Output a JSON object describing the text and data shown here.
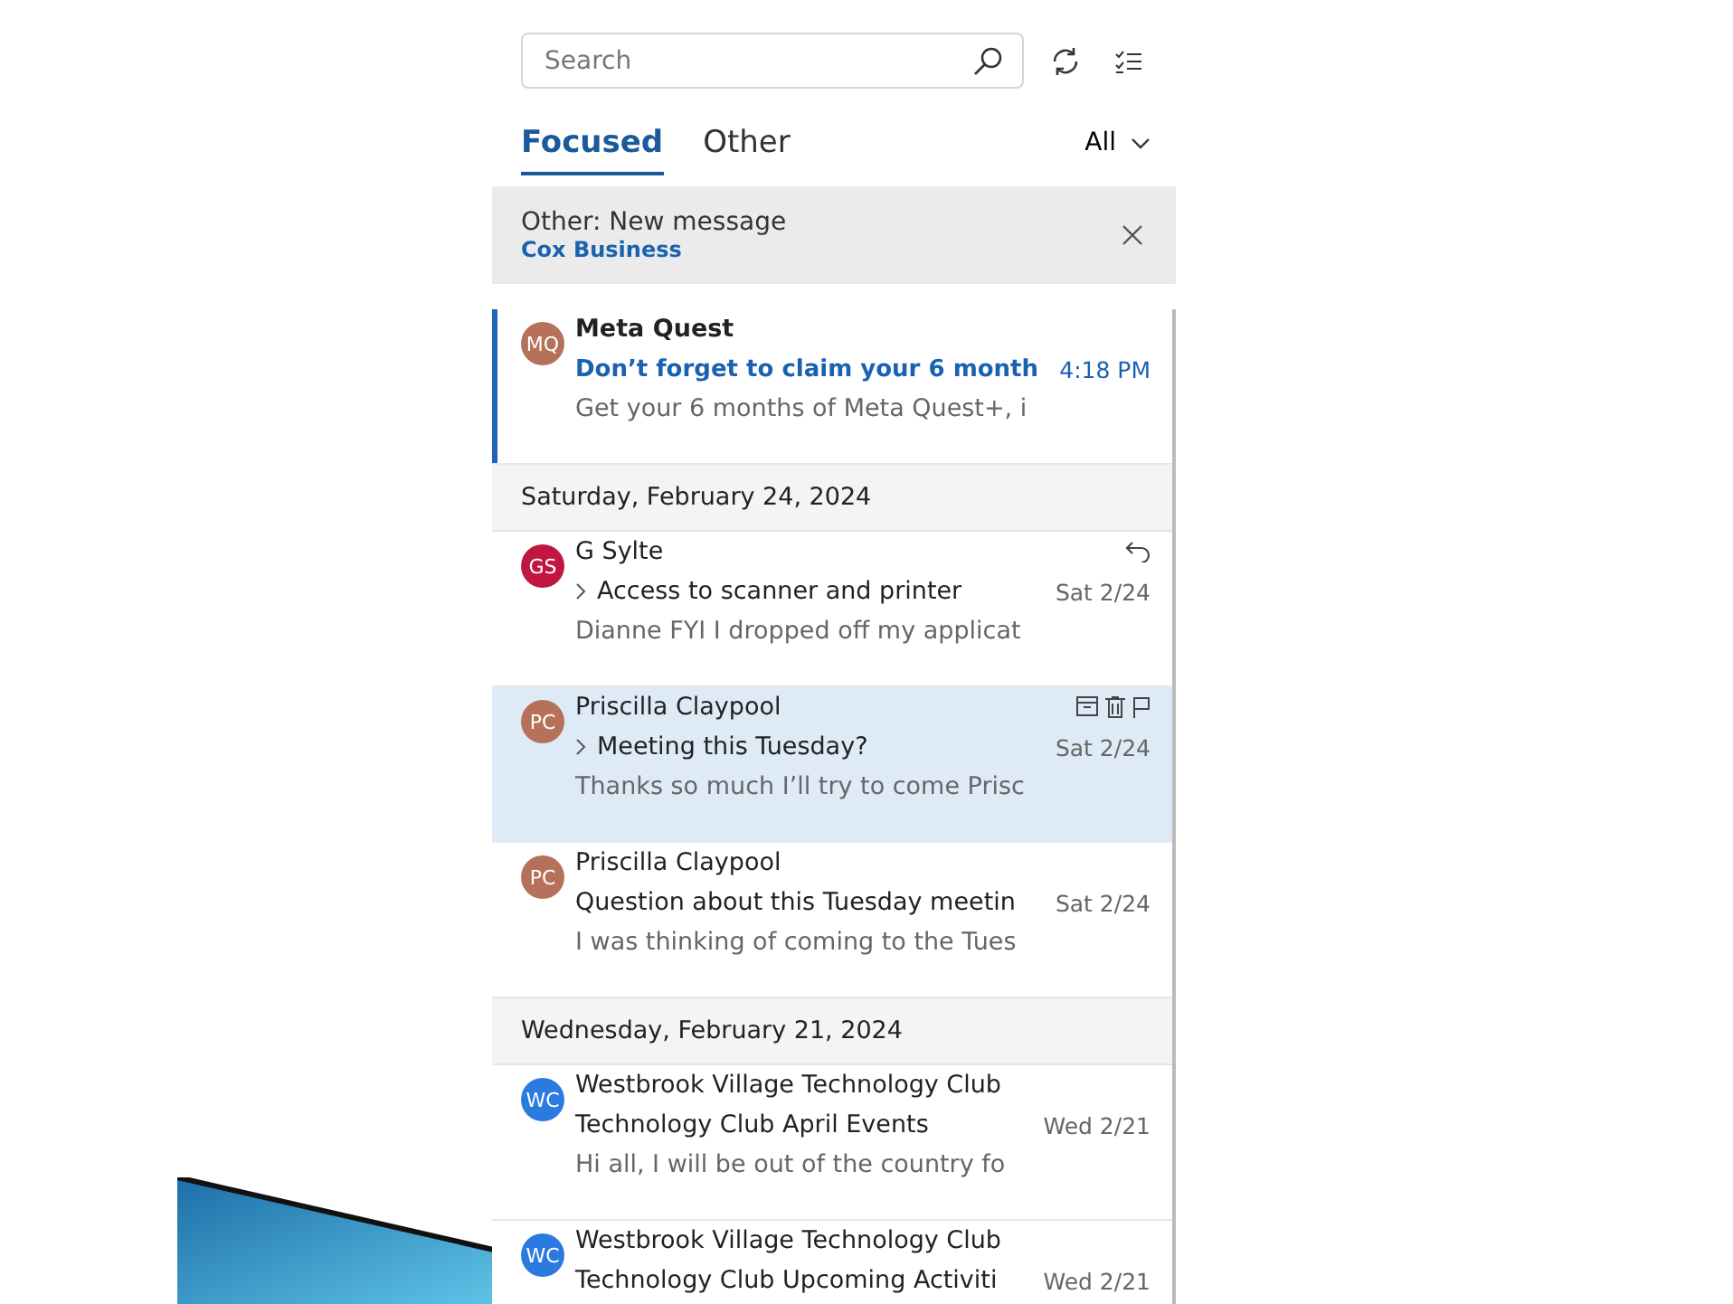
{
  "search": {
    "placeholder": "Search"
  },
  "tabs": [
    {
      "label": "Focused",
      "selected": true
    },
    {
      "label": "Other",
      "selected": false
    }
  ],
  "filter": {
    "label": "All"
  },
  "banner": {
    "title": "Other: New message",
    "sender": "Cox Business"
  },
  "items": [
    {
      "kind": "message",
      "initials": "MQ",
      "color": "#b5715a",
      "sender": "Meta Quest",
      "subject": "Don’t forget to claim your 6 month",
      "preview": "Get your 6 months of Meta Quest+, i",
      "time": "4:18 PM",
      "unread": true,
      "selected": true,
      "hovered": false,
      "thread": false,
      "replied": false
    },
    {
      "kind": "date",
      "label": "Saturday, February 24, 2024"
    },
    {
      "kind": "message",
      "initials": "GS",
      "color": "#c0163f",
      "sender": "G Sylte",
      "subject": "Access to scanner and printer",
      "preview": "Dianne FYI I dropped off my applicat",
      "time": "Sat 2/24",
      "unread": false,
      "selected": false,
      "hovered": false,
      "thread": true,
      "replied": true
    },
    {
      "kind": "message",
      "initials": "PC",
      "color": "#b5715a",
      "sender": "Priscilla Claypool",
      "subject": "Meeting this Tuesday?",
      "preview": "Thanks so much I’ll try to come Prisc",
      "time": "Sat 2/24",
      "unread": false,
      "selected": false,
      "hovered": true,
      "thread": true,
      "replied": false
    },
    {
      "kind": "message",
      "initials": "PC",
      "color": "#b5715a",
      "sender": "Priscilla Claypool",
      "subject": "Question about this Tuesday meetin",
      "preview": "I was thinking of coming to the Tues",
      "time": "Sat 2/24",
      "unread": false,
      "selected": false,
      "hovered": false,
      "thread": false,
      "replied": false
    },
    {
      "kind": "date",
      "label": "Wednesday, February 21, 2024"
    },
    {
      "kind": "message",
      "initials": "WC",
      "color": "#2b7ae0",
      "sender": "Westbrook Village Technology Club",
      "subject": "Technology Club April Events",
      "preview": "Hi all, I will be out of the country fo",
      "time": "Wed 2/21",
      "unread": false,
      "selected": false,
      "hovered": false,
      "thread": false,
      "replied": false
    },
    {
      "kind": "message",
      "initials": "WC",
      "color": "#2b7ae0",
      "sender": "Westbrook Village Technology Club",
      "subject": "Technology Club Upcoming Activiti",
      "time": "Wed 2/21",
      "unread": false,
      "selected": false,
      "hovered": false,
      "thread": false,
      "replied": false
    }
  ]
}
